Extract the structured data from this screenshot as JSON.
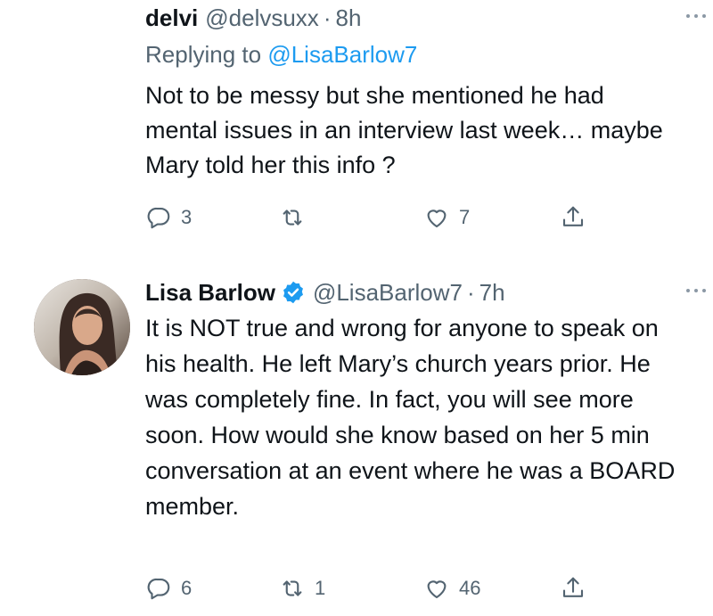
{
  "tweets": [
    {
      "name": "delvi",
      "handle": "@delvsuxx",
      "separator": "·",
      "time": "8h",
      "replying_prefix": "Replying to ",
      "replying_to": "@LisaBarlow7",
      "text": "Not to be messy but she mentioned he had mental issues in an interview last week… maybe Mary told her this info ?",
      "replies": "3",
      "retweets": "",
      "likes": "7",
      "verified": false
    },
    {
      "name": "Lisa Barlow",
      "handle": "@LisaBarlow7",
      "separator": "·",
      "time": "7h",
      "text": "It is NOT true and wrong for anyone to speak on his health. He left Mary’s church years prior.  He was completely fine. In fact, you will see  more soon.   How would she know based on her 5 min conversation at an event where he was a BOARD member.",
      "replies": "6",
      "retweets": "1",
      "likes": "46",
      "verified": true
    }
  ],
  "colors": {
    "text": "#0f1419",
    "secondary": "#536471",
    "accent": "#1d9bf0"
  }
}
